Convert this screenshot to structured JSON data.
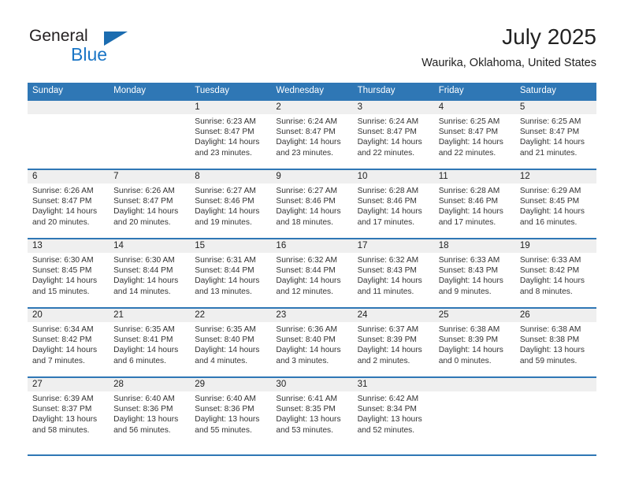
{
  "brand": {
    "name_part1": "General",
    "name_part2": "Blue",
    "triangle_color": "#1b6cb0",
    "blue_color": "#1b76c6"
  },
  "header": {
    "title": "July 2025",
    "subtitle": "Waurika, Oklahoma, United States"
  },
  "theme": {
    "header_bg": "#2f77b5",
    "daynum_band": "#efefef",
    "row_rule": "#2f77b5"
  },
  "weekdays": [
    "Sunday",
    "Monday",
    "Tuesday",
    "Wednesday",
    "Thursday",
    "Friday",
    "Saturday"
  ],
  "weeks": [
    [
      {
        "day": "",
        "sunrise": "",
        "sunset": "",
        "daylight1": "",
        "daylight2": ""
      },
      {
        "day": "",
        "sunrise": "",
        "sunset": "",
        "daylight1": "",
        "daylight2": ""
      },
      {
        "day": "1",
        "sunrise": "Sunrise: 6:23 AM",
        "sunset": "Sunset: 8:47 PM",
        "daylight1": "Daylight: 14 hours",
        "daylight2": "and 23 minutes."
      },
      {
        "day": "2",
        "sunrise": "Sunrise: 6:24 AM",
        "sunset": "Sunset: 8:47 PM",
        "daylight1": "Daylight: 14 hours",
        "daylight2": "and 23 minutes."
      },
      {
        "day": "3",
        "sunrise": "Sunrise: 6:24 AM",
        "sunset": "Sunset: 8:47 PM",
        "daylight1": "Daylight: 14 hours",
        "daylight2": "and 22 minutes."
      },
      {
        "day": "4",
        "sunrise": "Sunrise: 6:25 AM",
        "sunset": "Sunset: 8:47 PM",
        "daylight1": "Daylight: 14 hours",
        "daylight2": "and 22 minutes."
      },
      {
        "day": "5",
        "sunrise": "Sunrise: 6:25 AM",
        "sunset": "Sunset: 8:47 PM",
        "daylight1": "Daylight: 14 hours",
        "daylight2": "and 21 minutes."
      }
    ],
    [
      {
        "day": "6",
        "sunrise": "Sunrise: 6:26 AM",
        "sunset": "Sunset: 8:47 PM",
        "daylight1": "Daylight: 14 hours",
        "daylight2": "and 20 minutes."
      },
      {
        "day": "7",
        "sunrise": "Sunrise: 6:26 AM",
        "sunset": "Sunset: 8:47 PM",
        "daylight1": "Daylight: 14 hours",
        "daylight2": "and 20 minutes."
      },
      {
        "day": "8",
        "sunrise": "Sunrise: 6:27 AM",
        "sunset": "Sunset: 8:46 PM",
        "daylight1": "Daylight: 14 hours",
        "daylight2": "and 19 minutes."
      },
      {
        "day": "9",
        "sunrise": "Sunrise: 6:27 AM",
        "sunset": "Sunset: 8:46 PM",
        "daylight1": "Daylight: 14 hours",
        "daylight2": "and 18 minutes."
      },
      {
        "day": "10",
        "sunrise": "Sunrise: 6:28 AM",
        "sunset": "Sunset: 8:46 PM",
        "daylight1": "Daylight: 14 hours",
        "daylight2": "and 17 minutes."
      },
      {
        "day": "11",
        "sunrise": "Sunrise: 6:28 AM",
        "sunset": "Sunset: 8:46 PM",
        "daylight1": "Daylight: 14 hours",
        "daylight2": "and 17 minutes."
      },
      {
        "day": "12",
        "sunrise": "Sunrise: 6:29 AM",
        "sunset": "Sunset: 8:45 PM",
        "daylight1": "Daylight: 14 hours",
        "daylight2": "and 16 minutes."
      }
    ],
    [
      {
        "day": "13",
        "sunrise": "Sunrise: 6:30 AM",
        "sunset": "Sunset: 8:45 PM",
        "daylight1": "Daylight: 14 hours",
        "daylight2": "and 15 minutes."
      },
      {
        "day": "14",
        "sunrise": "Sunrise: 6:30 AM",
        "sunset": "Sunset: 8:44 PM",
        "daylight1": "Daylight: 14 hours",
        "daylight2": "and 14 minutes."
      },
      {
        "day": "15",
        "sunrise": "Sunrise: 6:31 AM",
        "sunset": "Sunset: 8:44 PM",
        "daylight1": "Daylight: 14 hours",
        "daylight2": "and 13 minutes."
      },
      {
        "day": "16",
        "sunrise": "Sunrise: 6:32 AM",
        "sunset": "Sunset: 8:44 PM",
        "daylight1": "Daylight: 14 hours",
        "daylight2": "and 12 minutes."
      },
      {
        "day": "17",
        "sunrise": "Sunrise: 6:32 AM",
        "sunset": "Sunset: 8:43 PM",
        "daylight1": "Daylight: 14 hours",
        "daylight2": "and 11 minutes."
      },
      {
        "day": "18",
        "sunrise": "Sunrise: 6:33 AM",
        "sunset": "Sunset: 8:43 PM",
        "daylight1": "Daylight: 14 hours",
        "daylight2": "and 9 minutes."
      },
      {
        "day": "19",
        "sunrise": "Sunrise: 6:33 AM",
        "sunset": "Sunset: 8:42 PM",
        "daylight1": "Daylight: 14 hours",
        "daylight2": "and 8 minutes."
      }
    ],
    [
      {
        "day": "20",
        "sunrise": "Sunrise: 6:34 AM",
        "sunset": "Sunset: 8:42 PM",
        "daylight1": "Daylight: 14 hours",
        "daylight2": "and 7 minutes."
      },
      {
        "day": "21",
        "sunrise": "Sunrise: 6:35 AM",
        "sunset": "Sunset: 8:41 PM",
        "daylight1": "Daylight: 14 hours",
        "daylight2": "and 6 minutes."
      },
      {
        "day": "22",
        "sunrise": "Sunrise: 6:35 AM",
        "sunset": "Sunset: 8:40 PM",
        "daylight1": "Daylight: 14 hours",
        "daylight2": "and 4 minutes."
      },
      {
        "day": "23",
        "sunrise": "Sunrise: 6:36 AM",
        "sunset": "Sunset: 8:40 PM",
        "daylight1": "Daylight: 14 hours",
        "daylight2": "and 3 minutes."
      },
      {
        "day": "24",
        "sunrise": "Sunrise: 6:37 AM",
        "sunset": "Sunset: 8:39 PM",
        "daylight1": "Daylight: 14 hours",
        "daylight2": "and 2 minutes."
      },
      {
        "day": "25",
        "sunrise": "Sunrise: 6:38 AM",
        "sunset": "Sunset: 8:39 PM",
        "daylight1": "Daylight: 14 hours",
        "daylight2": "and 0 minutes."
      },
      {
        "day": "26",
        "sunrise": "Sunrise: 6:38 AM",
        "sunset": "Sunset: 8:38 PM",
        "daylight1": "Daylight: 13 hours",
        "daylight2": "and 59 minutes."
      }
    ],
    [
      {
        "day": "27",
        "sunrise": "Sunrise: 6:39 AM",
        "sunset": "Sunset: 8:37 PM",
        "daylight1": "Daylight: 13 hours",
        "daylight2": "and 58 minutes."
      },
      {
        "day": "28",
        "sunrise": "Sunrise: 6:40 AM",
        "sunset": "Sunset: 8:36 PM",
        "daylight1": "Daylight: 13 hours",
        "daylight2": "and 56 minutes."
      },
      {
        "day": "29",
        "sunrise": "Sunrise: 6:40 AM",
        "sunset": "Sunset: 8:36 PM",
        "daylight1": "Daylight: 13 hours",
        "daylight2": "and 55 minutes."
      },
      {
        "day": "30",
        "sunrise": "Sunrise: 6:41 AM",
        "sunset": "Sunset: 8:35 PM",
        "daylight1": "Daylight: 13 hours",
        "daylight2": "and 53 minutes."
      },
      {
        "day": "31",
        "sunrise": "Sunrise: 6:42 AM",
        "sunset": "Sunset: 8:34 PM",
        "daylight1": "Daylight: 13 hours",
        "daylight2": "and 52 minutes."
      },
      {
        "day": "",
        "sunrise": "",
        "sunset": "",
        "daylight1": "",
        "daylight2": ""
      },
      {
        "day": "",
        "sunrise": "",
        "sunset": "",
        "daylight1": "",
        "daylight2": ""
      }
    ]
  ]
}
